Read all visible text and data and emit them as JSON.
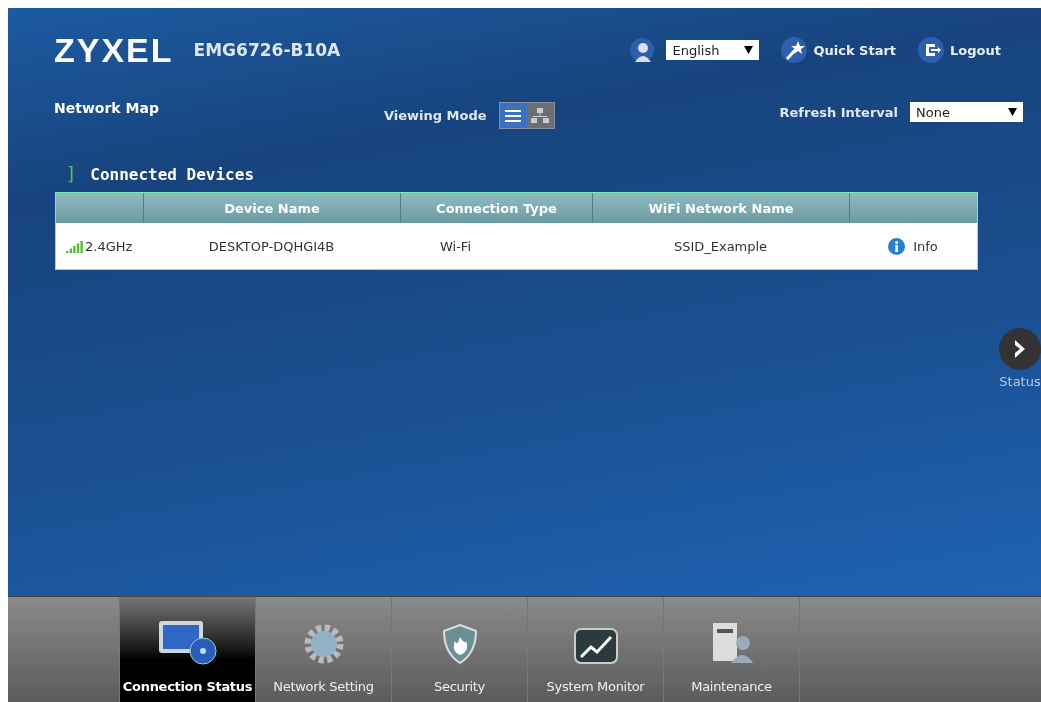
{
  "header": {
    "brand": "ZYXEL",
    "model": "EMG6726-B10A",
    "language": "English",
    "quick_start": "Quick Start",
    "logout": "Logout"
  },
  "page_title": "Network Map",
  "viewing_mode": {
    "label": "Viewing Mode",
    "modes": [
      {
        "kind": "list",
        "selected": true
      },
      {
        "kind": "topology",
        "selected": false
      }
    ]
  },
  "refresh_interval": {
    "label": "Refresh Interval",
    "value": "None"
  },
  "section": {
    "marker": "]",
    "title": "Connected Devices"
  },
  "table": {
    "columns": [
      "",
      "Device Name",
      "Connection Type",
      "WiFi Network Name",
      ""
    ],
    "rows": [
      {
        "band": "2.4GHz",
        "device_name": "DESKTOP-DQHGI4B",
        "connection_type": "Wi-Fi",
        "wifi_network_name": "SSID_Example",
        "action": "Info"
      }
    ]
  },
  "side_panel": {
    "label": "Status"
  },
  "nav": [
    {
      "kind": "monitor",
      "label": "Connection Status",
      "selected": true
    },
    {
      "kind": "gear",
      "label": "Network Setting",
      "selected": false
    },
    {
      "kind": "shield",
      "label": "Security",
      "selected": false
    },
    {
      "kind": "chart",
      "label": "System Monitor",
      "selected": false
    },
    {
      "kind": "tools",
      "label": "Maintenance",
      "selected": false
    }
  ]
}
